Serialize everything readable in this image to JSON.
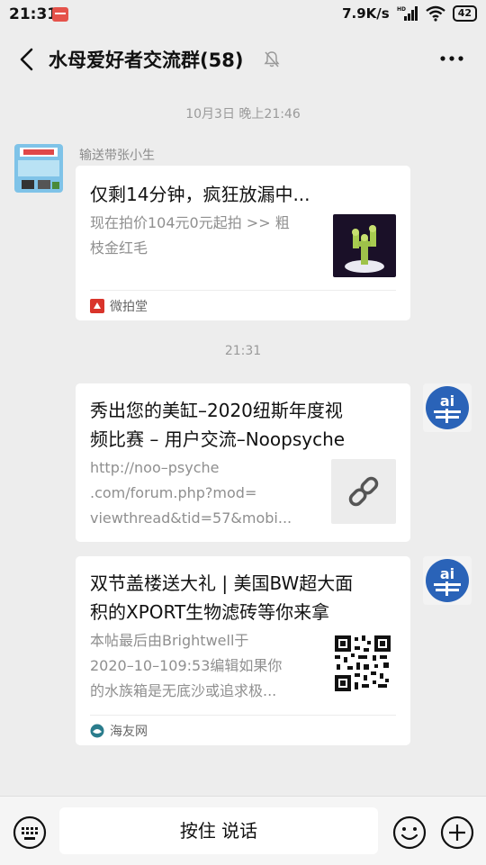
{
  "status": {
    "time": "21:31",
    "speed": "7.9K/s",
    "network": "HD",
    "battery": "42"
  },
  "header": {
    "title": "水母爱好者交流群(58)"
  },
  "messages": [
    {
      "timestamp": "10月3日 晚上21:46",
      "sender": "输送带张小生",
      "card_title": "仅剩14分钟，疯狂放漏中...",
      "card_desc_line1": "现在拍价104元0元起拍 >> 粗",
      "card_desc_line2": "枝金红毛",
      "source": "微拍堂"
    },
    {
      "timestamp": "21:31",
      "card_title_line1": "秀出您的美缸–2020纽斯年度视",
      "card_title_line2": "频比赛 – 用户交流–Noopsyche",
      "card_desc_line1": "http://noo–psyche",
      "card_desc_line2": ".com/forum.php?mod=",
      "card_desc_line3": "viewthread&tid=57&mobi..."
    },
    {
      "card_title_line1": "双节盖楼送大礼 | 美国BW超大面",
      "card_title_line2": "积的XPORT生物滤砖等你来拿",
      "card_desc_line1": "本帖最后由Brightwell于",
      "card_desc_line2": "2020–10–109:53编辑如果你",
      "card_desc_line3": "的水族箱是无底沙或追求极...",
      "source": "海友网"
    }
  ],
  "input": {
    "voice_label": "按住 说话"
  },
  "colors": {
    "background": "#ededed",
    "card": "#ffffff",
    "avatar_blue": "#2a63b8",
    "source_red": "#d9342b"
  }
}
